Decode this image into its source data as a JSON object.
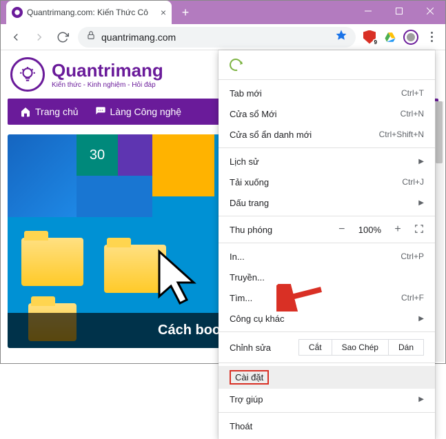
{
  "tab": {
    "title": "Quantrimang.com: Kiến Thức Cô"
  },
  "address": {
    "url": "quantrimang.com"
  },
  "extensions": {
    "shield_badge": "9"
  },
  "site": {
    "brand": "Quantrimang",
    "tagline": "Kiến thức - Kinh nghiệm - Hỏi đáp",
    "nav": {
      "home": "Trang chủ",
      "tech": "Làng Công nghệ"
    },
    "tile_date": "30",
    "hero_caption": "Cách bookmark thư"
  },
  "menu": {
    "new_tab": {
      "label": "Tab mới",
      "shortcut": "Ctrl+T"
    },
    "new_window": {
      "label": "Cửa sổ Mới",
      "shortcut": "Ctrl+N"
    },
    "incognito": {
      "label": "Cửa sổ ẩn danh mới",
      "shortcut": "Ctrl+Shift+N"
    },
    "history": {
      "label": "Lịch sử"
    },
    "downloads": {
      "label": "Tải xuống",
      "shortcut": "Ctrl+J"
    },
    "bookmarks": {
      "label": "Dấu trang"
    },
    "zoom": {
      "label": "Thu phóng",
      "value": "100%",
      "minus": "−",
      "plus": "+"
    },
    "print": {
      "label": "In...",
      "shortcut": "Ctrl+P"
    },
    "cast": {
      "label": "Truyền..."
    },
    "find": {
      "label": "Tìm...",
      "shortcut": "Ctrl+F"
    },
    "more_tools": {
      "label": "Công cụ khác"
    },
    "edit": {
      "label": "Chỉnh sửa",
      "cut": "Cắt",
      "copy": "Sao Chép",
      "paste": "Dán"
    },
    "settings": {
      "label": "Cài đặt"
    },
    "help": {
      "label": "Trợ giúp"
    },
    "exit": {
      "label": "Thoát"
    }
  }
}
